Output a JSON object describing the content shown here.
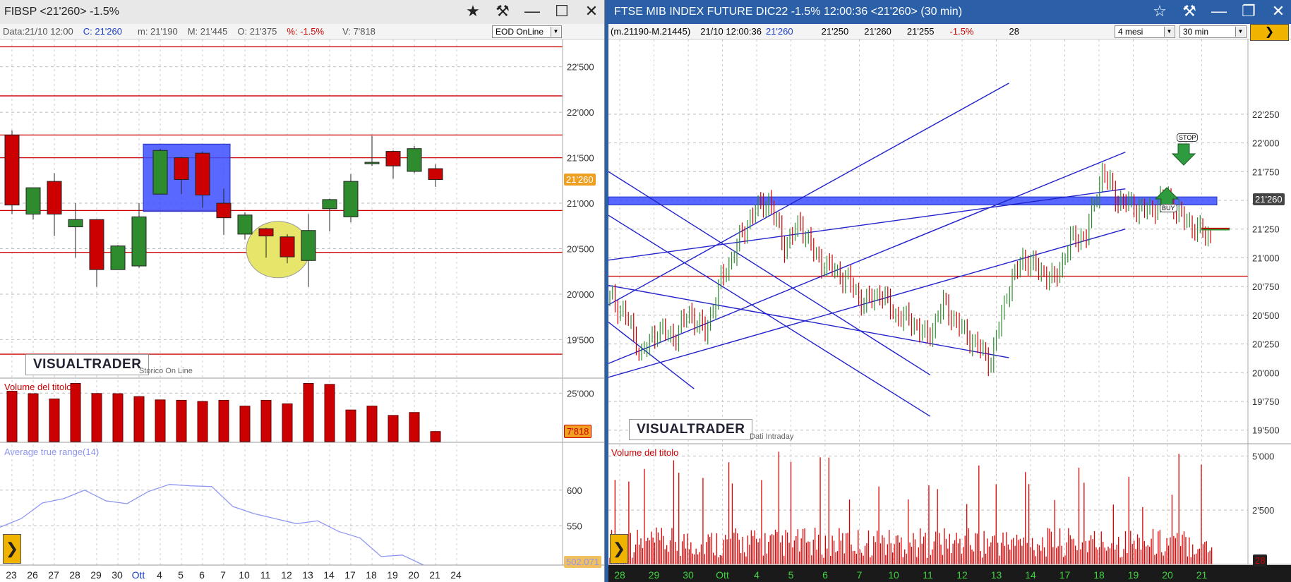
{
  "left": {
    "title": "FIBSP  <21'260>  -1.5%",
    "info": {
      "data": "Data:21/10 12:00",
      "c": "C: 21'260",
      "m": "m: 21'190",
      "M": "M: 21'445",
      "o": "O: 21'375",
      "pct": "%: -1.5%",
      "v": "V: 7'818"
    },
    "feed": "EOD OnLine",
    "logo": "VISUALTRADER",
    "logo_sub": "Storico On Line",
    "price_badge": "21'260",
    "vol_badge": "7'818",
    "atr_badge": "502.071",
    "vol_title": "Volume del titolo",
    "atr_title": "Average true range(14)",
    "colors": {
      "up": "#2e8b2e",
      "down": "#cc0000",
      "sr": "#cc0000",
      "box": "#3c4dff",
      "circle": "#e8e66a",
      "atr": "#8f96f0"
    }
  },
  "right": {
    "title": "FTSE MIB INDEX FUTURE DIC22 -1.5% 12:00:36  <21'260>  (30 min)",
    "info": {
      "range": "(m.21190-M.21445)",
      "ts": "21/10 12:00:36",
      "c": "21'260",
      "a": "21'250",
      "b": "21'260",
      "d": "21'255",
      "pct": "-1.5%",
      "n": "28"
    },
    "period": "4 mesi",
    "interval": "30 min",
    "logo": "VISUALTRADER",
    "logo_sub": "Dati Intraday",
    "price_badge": "21'260",
    "vol_badge": "28",
    "vol_title": "Volume del titolo",
    "stop_label": "STOP",
    "buy_label": "BUY",
    "colors": {
      "trend": "#2222cc",
      "zone": "#3c4dff",
      "sr": "#cc0000",
      "vol": "#dd0000",
      "up": "#2e8b2e",
      "down": "#cc0000"
    }
  },
  "chart_data": [
    {
      "type": "candlestick",
      "title": "FIBSP",
      "ylim": [
        19100,
        22800
      ],
      "yticks": [
        19500,
        20000,
        20500,
        21000,
        21500,
        22000,
        22500
      ],
      "ytick_labels": [
        "19'500",
        "20'000",
        "20'500",
        "21'000",
        "21'500",
        "22'000",
        "22'500"
      ],
      "categories": [
        "23",
        "26",
        "27",
        "28",
        "29",
        "30",
        "Ott",
        "4",
        "5",
        "6",
        "7",
        "10",
        "11",
        "12",
        "13",
        "14",
        "17",
        "18",
        "19",
        "20",
        "21",
        "24"
      ],
      "candles": [
        {
          "o": 21750,
          "h": 21800,
          "l": 20880,
          "c": 20980
        },
        {
          "o": 20880,
          "h": 21160,
          "l": 20820,
          "c": 21170
        },
        {
          "o": 21240,
          "h": 21330,
          "l": 20640,
          "c": 20880
        },
        {
          "o": 20740,
          "h": 21000,
          "l": 20400,
          "c": 20820
        },
        {
          "o": 20820,
          "h": 20820,
          "l": 20080,
          "c": 20270
        },
        {
          "o": 20270,
          "h": 20540,
          "l": 20270,
          "c": 20530
        },
        {
          "o": 20310,
          "h": 21000,
          "l": 20290,
          "c": 20850
        },
        {
          "o": 21100,
          "h": 21600,
          "l": 21100,
          "c": 21580
        },
        {
          "o": 21500,
          "h": 21510,
          "l": 21100,
          "c": 21260
        },
        {
          "o": 21550,
          "h": 21570,
          "l": 20950,
          "c": 21090
        },
        {
          "o": 21000,
          "h": 21160,
          "l": 20650,
          "c": 20840
        },
        {
          "o": 20660,
          "h": 20900,
          "l": 20600,
          "c": 20870
        },
        {
          "o": 20720,
          "h": 20730,
          "l": 20400,
          "c": 20640
        },
        {
          "o": 20630,
          "h": 20660,
          "l": 20340,
          "c": 20410
        },
        {
          "o": 20370,
          "h": 20880,
          "l": 20080,
          "c": 20700
        },
        {
          "o": 20940,
          "h": 21050,
          "l": 20690,
          "c": 21040
        },
        {
          "o": 20850,
          "h": 21320,
          "l": 20790,
          "c": 21240
        },
        {
          "o": 21440,
          "h": 21740,
          "l": 21410,
          "c": 21450
        },
        {
          "o": 21570,
          "h": 21580,
          "l": 21270,
          "c": 21410
        },
        {
          "o": 21350,
          "h": 21630,
          "l": 21330,
          "c": 21600
        },
        {
          "o": 21380,
          "h": 21430,
          "l": 21180,
          "c": 21260
        },
        null
      ],
      "hlines": [
        22720,
        22180,
        21750,
        21500,
        20920,
        20460,
        19340
      ],
      "volume": {
        "ylim": [
          0,
          32000
        ],
        "ytick": 25000,
        "ytick_label": "25'000",
        "values": [
          26000,
          24700,
          22000,
          30000,
          24800,
          24700,
          23200,
          21500,
          21300,
          20700,
          21300,
          18300,
          21300,
          19500,
          30000,
          29500,
          16300,
          18300,
          13500,
          15000,
          5200
        ]
      },
      "atr": {
        "ylim": [
          495,
          665
        ],
        "yticks": [
          550,
          600
        ],
        "ytick_labels": [
          "550",
          "600"
        ],
        "values": [
          548,
          560,
          582,
          588,
          600,
          585,
          581,
          598,
          608,
          606,
          605,
          577,
          567,
          560,
          553,
          557,
          542,
          533,
          507,
          509,
          495
        ]
      }
    },
    {
      "type": "candlestick-intraday",
      "title": "FTSE MIB INDEX FUTURE DIC22",
      "ylim": [
        19400,
        22900
      ],
      "yticks": [
        19500,
        19750,
        20000,
        20250,
        20500,
        20750,
        21000,
        21250,
        21500,
        21750,
        22000,
        22250
      ],
      "ytick_labels": [
        "19'500",
        "19'750",
        "20'000",
        "20'250",
        "20'500",
        "20'750",
        "21'000",
        "21'250",
        "21'500",
        "21'750",
        "22'000",
        "22'250"
      ],
      "categories": [
        "28",
        "29",
        "30",
        "Ott",
        "4",
        "5",
        "6",
        "7",
        "10",
        "11",
        "12",
        "13",
        "14",
        "17",
        "18",
        "19",
        "20",
        "21"
      ],
      "closes": [
        20650,
        20500,
        20150,
        20380,
        20300,
        20520,
        20350,
        20800,
        21100,
        21400,
        21500,
        21100,
        21300,
        21000,
        20900,
        20800,
        20600,
        20700,
        20500,
        20450,
        20300,
        20600,
        20400,
        20250,
        20100,
        20700,
        21000,
        20900,
        20800,
        21150,
        21200,
        21750,
        21500,
        21450,
        21400,
        21550,
        21350,
        21250,
        21150
      ],
      "zone": [
        21460,
        21530
      ],
      "hline": 20840,
      "volume": {
        "ytick": [
          5000,
          2500
        ],
        "ytick_labels": [
          "5'000",
          "2'500"
        ],
        "ymax": 5500
      }
    }
  ]
}
